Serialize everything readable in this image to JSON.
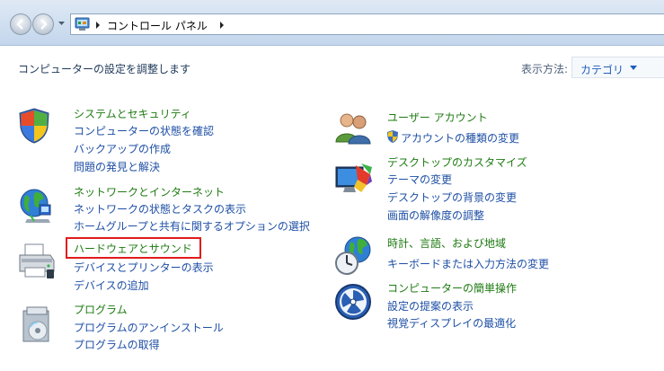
{
  "address_bar": {
    "location": "コントロール パネル"
  },
  "header": {
    "title": "コンピューターの設定を調整します",
    "view_by_label": "表示方法:",
    "view_by_value": "カテゴリ"
  },
  "left": {
    "system": {
      "title": "システムとセキュリティ",
      "links": [
        "コンピューターの状態を確認",
        "バックアップの作成",
        "問題の発見と解決"
      ]
    },
    "network": {
      "title": "ネットワークとインターネット",
      "links": [
        "ネットワークの状態とタスクの表示",
        "ホームグループと共有に関するオプションの選択"
      ]
    },
    "hardware": {
      "title": "ハードウェアとサウンド",
      "links": [
        "デバイスとプリンターの表示",
        "デバイスの追加"
      ]
    },
    "programs": {
      "title": "プログラム",
      "links": [
        "プログラムのアンインストール",
        "プログラムの取得"
      ]
    }
  },
  "right": {
    "user": {
      "title": "ユーザー アカウント",
      "links": [
        "アカウントの種類の変更"
      ]
    },
    "appearance": {
      "title": "デスクトップのカスタマイズ",
      "links": [
        "テーマの変更",
        "デスクトップの背景の変更",
        "画面の解像度の調整"
      ]
    },
    "clock": {
      "title": "時計、言語、および地域",
      "links": [
        "キーボードまたは入力方法の変更"
      ]
    },
    "ease": {
      "title": "コンピューターの簡単操作",
      "links": [
        "設定の提案の表示",
        "視覚ディスプレイの最適化"
      ]
    }
  },
  "colors": {
    "category_title": "#1e7b12",
    "link": "#1e4fa5",
    "highlight": "#e01b1b"
  }
}
